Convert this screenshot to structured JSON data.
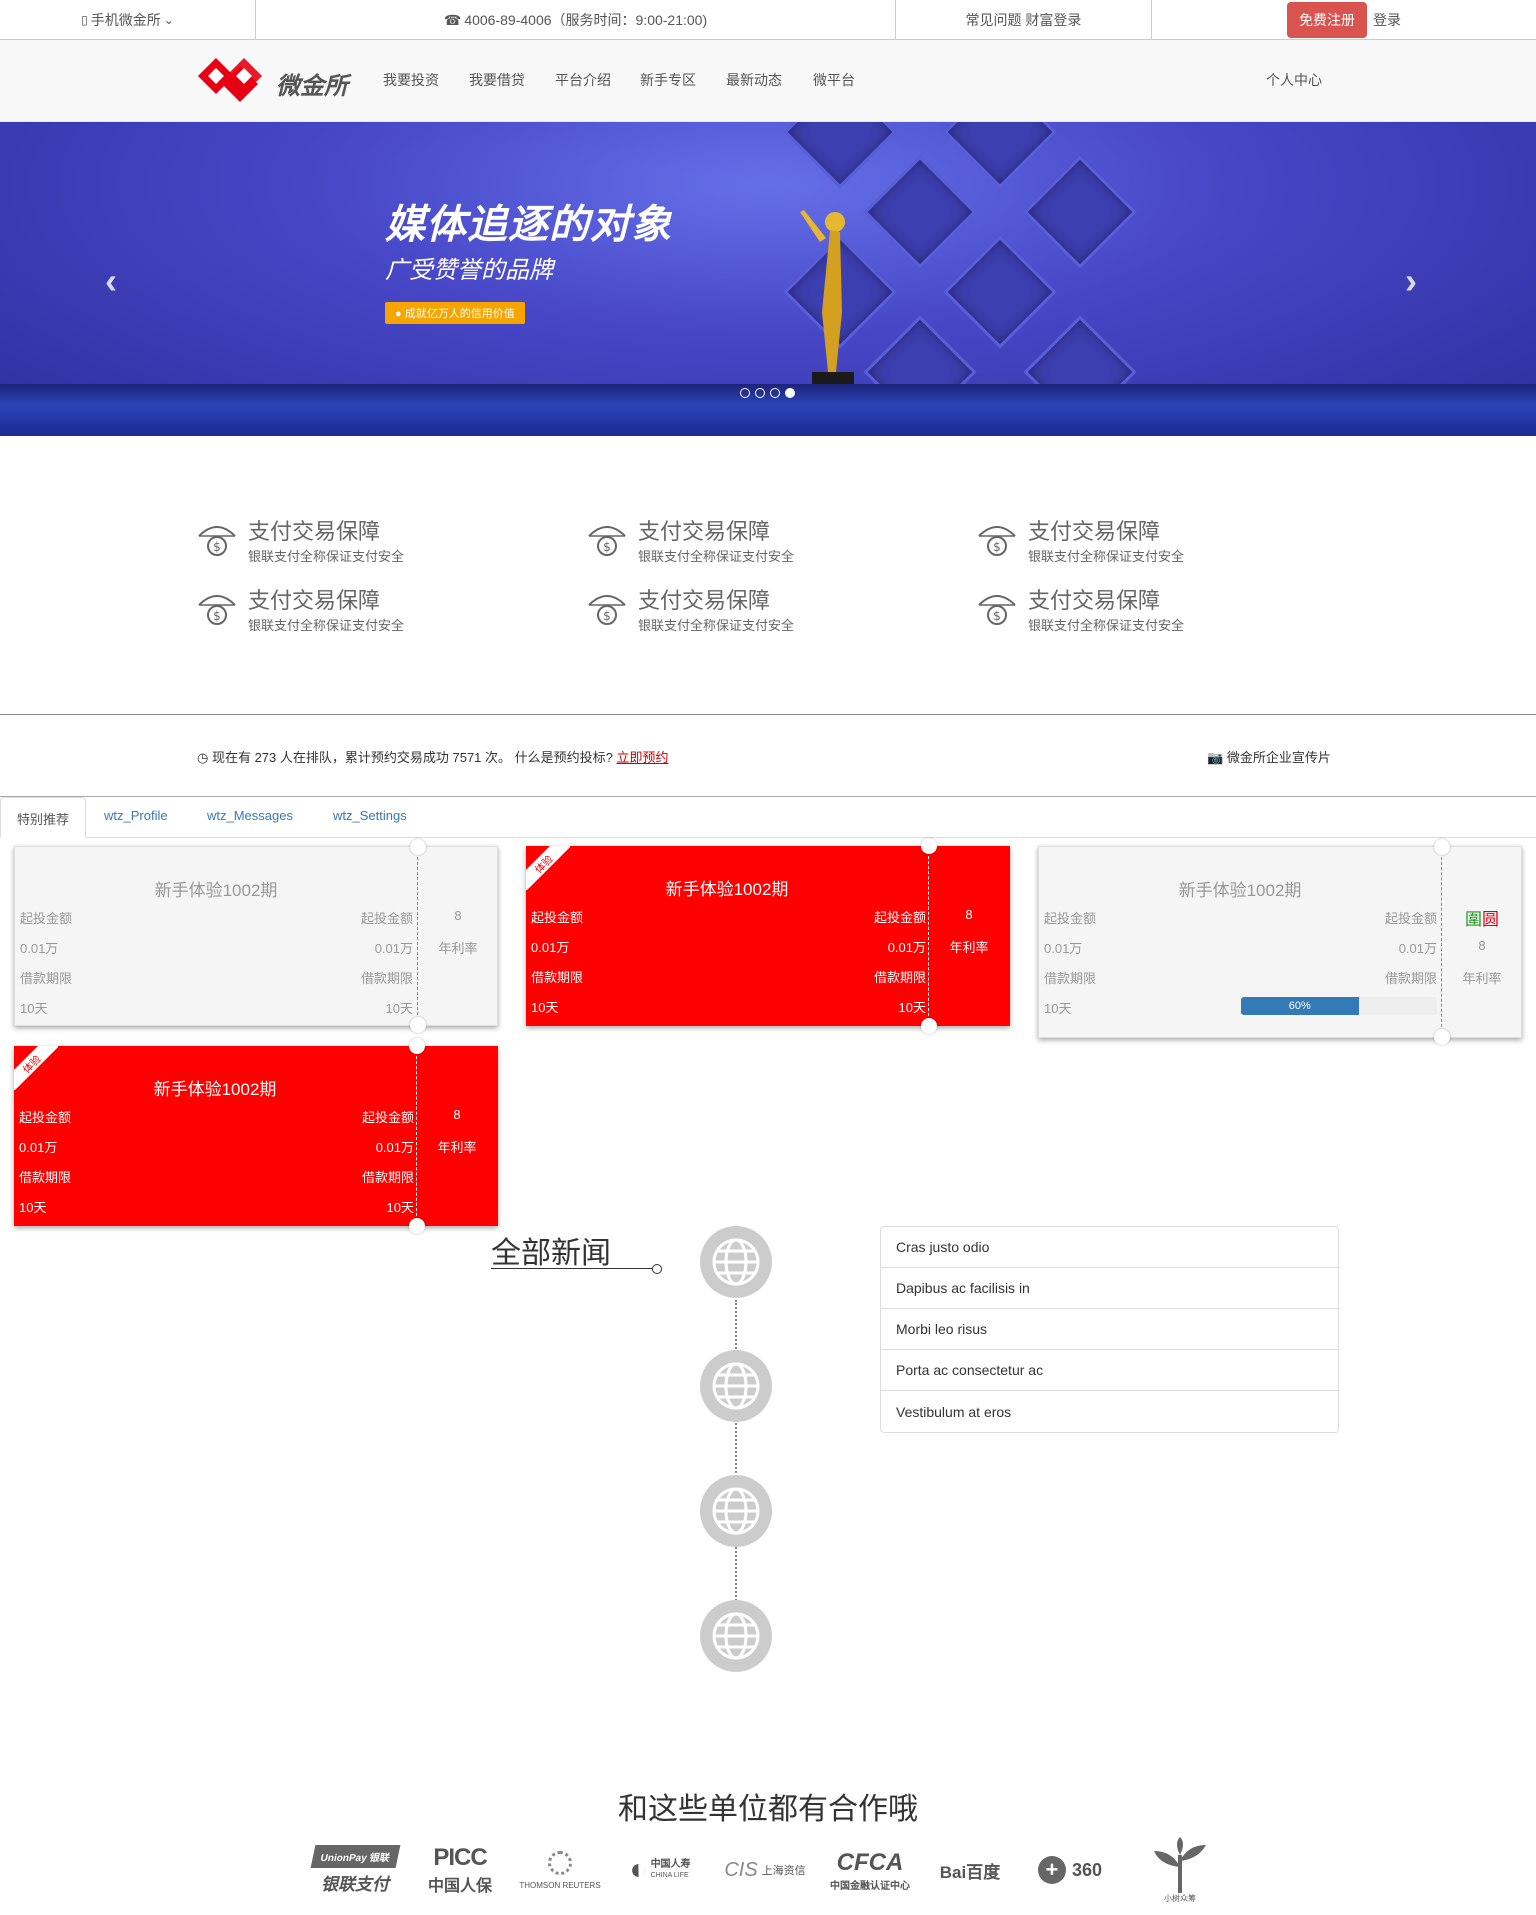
{
  "topbar": {
    "mobile": "手机微金所",
    "phone": "4006-89-4006（服务时间：9:00-21:00)",
    "faq": "常见问题 财富登录",
    "register": "免费注册",
    "login": "登录"
  },
  "nav": {
    "logo_text": "微金所",
    "items": [
      "我要投资",
      "我要借贷",
      "平台介绍",
      "新手专区",
      "最新动态",
      "微平台"
    ],
    "user_center": "个人中心"
  },
  "banner": {
    "title": "媒体追逐的对象",
    "subtitle": "广受赞誉的品牌",
    "badge": "成就亿万人的信用价值",
    "slide_count": 4,
    "active_slide": 4
  },
  "features": [
    {
      "title": "支付交易保障",
      "desc": "银联支付全称保证支付安全"
    },
    {
      "title": "支付交易保障",
      "desc": "银联支付全称保证支付安全"
    },
    {
      "title": "支付交易保障",
      "desc": "银联支付全称保证支付安全"
    },
    {
      "title": "支付交易保障",
      "desc": "银联支付全称保证支付安全"
    },
    {
      "title": "支付交易保障",
      "desc": "银联支付全称保证支付安全"
    },
    {
      "title": "支付交易保障",
      "desc": "银联支付全称保证支付安全"
    }
  ],
  "queue": {
    "text": "现在有 273 人在排队，累计预约交易成功 7571 次。 什么是预约投标?",
    "link": "立即预约",
    "video": "微金所企业宣传片"
  },
  "tabs": [
    "特别推荐",
    "wtz_Profile",
    "wtz_Messages",
    "wtz_Settings"
  ],
  "cards": [
    {
      "title": "新手体验1002期",
      "row1_l": "起投金额",
      "row1_r": "起投金额",
      "row2_l": "0.01万",
      "row2_r": "0.01万",
      "row3_l": "借款期限",
      "row3_r": "借款期限",
      "row4_l": "10天",
      "row4_r": "10天",
      "rate": "8",
      "rate_label": "年利率",
      "style": "grey"
    },
    {
      "title": "新手体验1002期",
      "ribbon": "体验",
      "row1_l": "起投金额",
      "row1_r": "起投金额",
      "row2_l": "0.01万",
      "row2_r": "0.01万",
      "row3_l": "借款期限",
      "row3_r": "借款期限",
      "row4_l": "10天",
      "row4_r": "10天",
      "rate": "8",
      "rate_label": "年利率",
      "style": "red"
    },
    {
      "title": "新手体验1002期",
      "row1_l": "起投金额",
      "row1_r": "起投金额",
      "row2_l": "0.01万",
      "row2_r": "0.01万",
      "row3_l": "借款期限",
      "row3_r": "借款期限",
      "row4_l": "10天",
      "stamp": "圍圆",
      "rate": "8",
      "rate_label": "年利率",
      "progress": 60,
      "progress_label": "60%",
      "style": "grey"
    },
    {
      "title": "新手体验1002期",
      "ribbon": "体验",
      "row1_l": "起投金额",
      "row1_r": "起投金额",
      "row2_l": "0.01万",
      "row2_r": "0.01万",
      "row3_l": "借款期限",
      "row3_r": "借款期限",
      "row4_l": "10天",
      "row4_r": "10天",
      "rate": "8",
      "rate_label": "年利率",
      "style": "red"
    }
  ],
  "news": {
    "title": "全部新闻",
    "items": [
      "Cras justo odio",
      "Dapibus ac facilisis in",
      "Morbi leo risus",
      "Porta ac consectetur ac",
      "Vestibulum at eros"
    ]
  },
  "partners": {
    "title": "和这些单位都有合作哦",
    "logos": [
      {
        "name": "UnionPay 银联",
        "sub": "银联支付"
      },
      {
        "name": "PICC",
        "sub": "中国人保"
      },
      {
        "name": "",
        "sub": "THOMSON REUTERS"
      },
      {
        "name": "中国人寿",
        "sub": "CHINA LIFE"
      },
      {
        "name": "CIS",
        "sub": "上海资信"
      },
      {
        "name": "CFCA",
        "sub": "中国金融认证中心"
      },
      {
        "name": "Bai百度",
        "sub": ""
      },
      {
        "name": "360",
        "sub": ""
      },
      {
        "name": "",
        "sub": "小树众筹"
      }
    ]
  }
}
